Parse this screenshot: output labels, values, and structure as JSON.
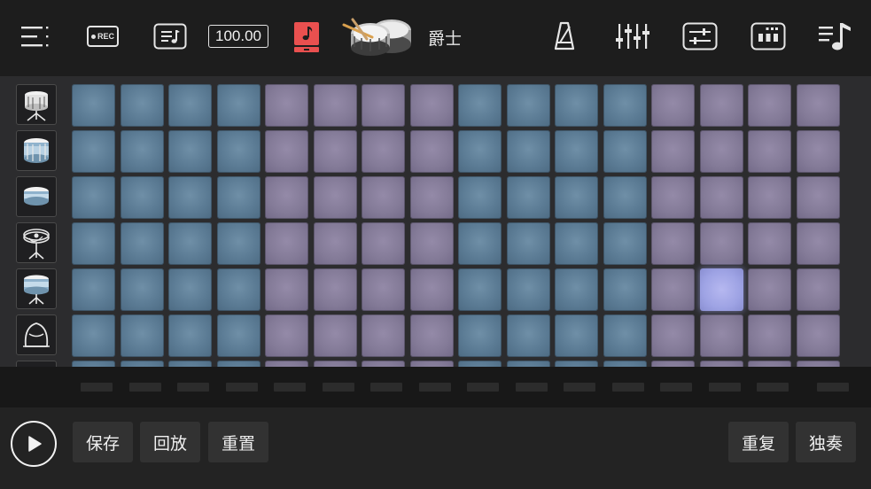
{
  "toolbar": {
    "rec_label": "REC",
    "tempo": "100.00",
    "kit_name": "爵士",
    "accent_color": "#e9504f"
  },
  "icons": [
    "menu-icon",
    "record-icon",
    "song-list-icon",
    "tempo-display",
    "note-icon",
    "drum-kit-icon",
    "metronome-icon",
    "mixer-icon",
    "settings-sliders-icon",
    "pad-grid-icon",
    "music-list-icon"
  ],
  "instruments": [
    {
      "name": "snare-drum-on-stand-icon"
    },
    {
      "name": "bass-drum-icon"
    },
    {
      "name": "snare-drum-icon"
    },
    {
      "name": "hi-hat-icon"
    },
    {
      "name": "tom-drum-icon"
    },
    {
      "name": "floor-tom-icon"
    }
  ],
  "pattern": {
    "columns": 16,
    "visible_rows": 6,
    "group_colors": [
      "blue",
      "purple",
      "blue",
      "purple"
    ],
    "active_cells": [
      [
        4,
        13
      ]
    ],
    "colors": {
      "blue": "#5b7b94",
      "purple": "#847b98",
      "active": "#a4a8ea"
    }
  },
  "bottom": {
    "save": "保存",
    "playback": "回放",
    "reset": "重置",
    "repeat": "重复",
    "solo": "独奏"
  }
}
